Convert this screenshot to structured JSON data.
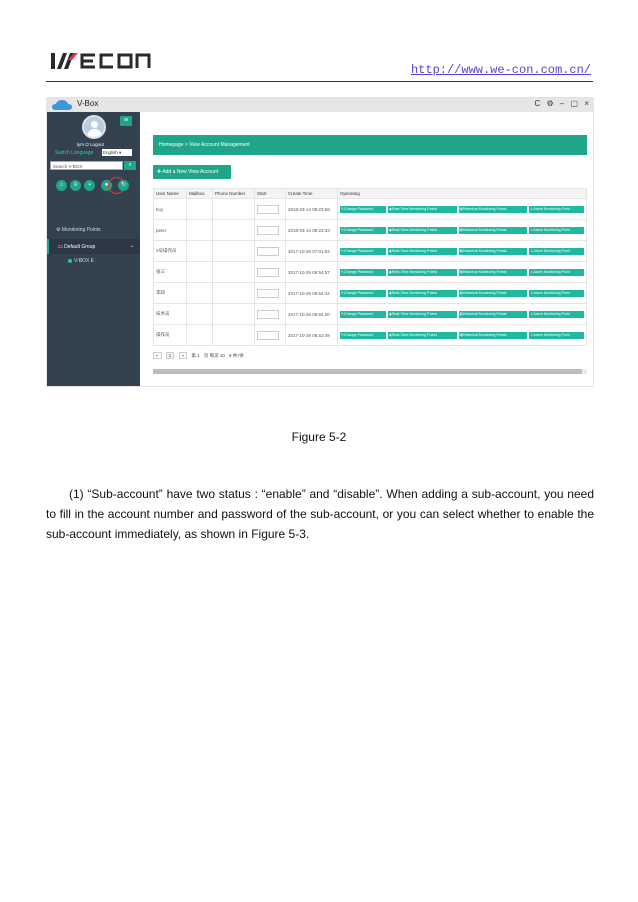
{
  "header": {
    "logo_text": "WECON",
    "url": "http://www.we-con.com.cn/"
  },
  "window": {
    "title": "V-Box",
    "controls": "C ⚙  –  ▢  ×"
  },
  "sidebar": {
    "user_line": "lym  ⏻ Logout",
    "switch_language_label": "Switch Language",
    "language_value": "English ▾",
    "search_placeholder": "Search V-BOX",
    "search_icon": "search-icon",
    "nav_icons": [
      "home-icon",
      "list-icon",
      "box-icon",
      "user-icon",
      "refresh-icon"
    ],
    "monitoring_points": "Monitoring Points",
    "default_group": "Default Group",
    "vbox_item": "V-BOX E"
  },
  "main": {
    "breadcrumb": "Homepage > View Account Management",
    "add_button": "Add a New View Account",
    "columns": [
      "User Name",
      "Mailbox",
      "Phone Number",
      "Start",
      "Create Time",
      "Operating"
    ],
    "operations": [
      "Change Password",
      "Real-Time Monitoring Points",
      "Historical Monitoring Points",
      "Alarm Monitoring Point"
    ],
    "rows": [
      {
        "user": "boy",
        "create_time": "2018-03-14 09:23:56"
      },
      {
        "user": "peter",
        "create_time": "2018-03-14 09:23:43"
      },
      {
        "user": "2号操作员",
        "create_time": "2017-10-26 07:01:04"
      },
      {
        "user": "张三",
        "create_time": "2017-10-26 06:54:57"
      },
      {
        "user": "李四",
        "create_time": "2017-10-26 06:54:44"
      },
      {
        "user": "技术员",
        "create_time": "2017-10-26 06:54:20"
      },
      {
        "user": "操作员",
        "create_time": "2017-10-26 06:53:49"
      }
    ],
    "pager": {
      "prev": "«",
      "page": "1",
      "next": "»",
      "page_label": "第 1",
      "per_page": "页 每页 10",
      "total": "▾ 共7条"
    }
  },
  "caption": "Figure 5-2",
  "paragraph": "(1) “Sub-account” have two status : “enable” and “disable”. When adding a sub-account, you need to fill in the account number and password of the sub-account, or you can select whether to enable the sub-account immediately, as shown in Figure 5-3.",
  "colors": {
    "accent": "#1fa58a",
    "sidebar": "#34414e",
    "link": "#5a3fd6",
    "highlight_ring": "#e53935"
  }
}
